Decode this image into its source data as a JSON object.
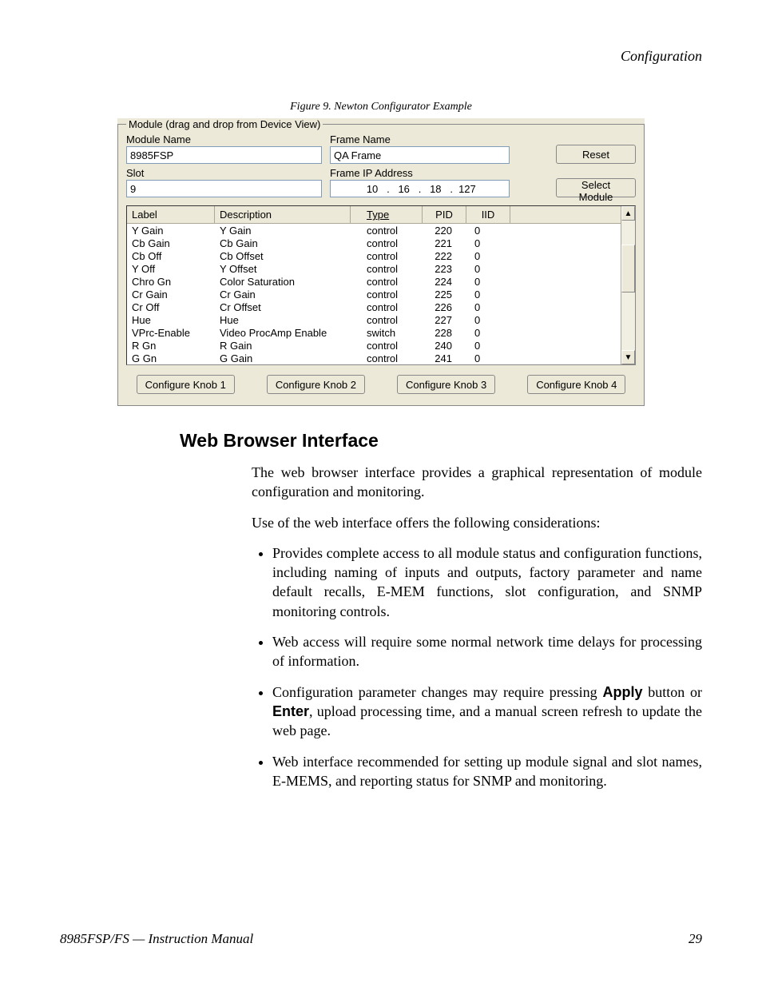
{
  "header": {
    "section": "Configuration"
  },
  "figure": {
    "caption": "Figure 9.  Newton Configurator Example"
  },
  "configurator": {
    "legend": "Module (drag and drop from Device View)",
    "module_name_label": "Module Name",
    "module_name_value": "8985FSP",
    "frame_name_label": "Frame Name",
    "frame_name_value": "QA Frame",
    "slot_label": "Slot",
    "slot_value": "9",
    "frame_ip_label": "Frame IP Address",
    "ip": {
      "o1": "10",
      "o2": "16",
      "o3": "18",
      "o4": "127"
    },
    "reset_btn": "Reset",
    "select_btn": "Select Module",
    "headers": {
      "label": "Label",
      "description": "Description",
      "type": "Type",
      "pid": "PID",
      "iid": "IID"
    },
    "rows": [
      {
        "label": "Y Gain",
        "desc": "Y Gain",
        "type": "control",
        "pid": "220",
        "iid": "0"
      },
      {
        "label": "Cb Gain",
        "desc": "Cb Gain",
        "type": "control",
        "pid": "221",
        "iid": "0"
      },
      {
        "label": "Cb Off",
        "desc": "Cb Offset",
        "type": "control",
        "pid": "222",
        "iid": "0"
      },
      {
        "label": "Y Off",
        "desc": "Y Offset",
        "type": "control",
        "pid": "223",
        "iid": "0"
      },
      {
        "label": "Chro Gn",
        "desc": "Color Saturation",
        "type": "control",
        "pid": "224",
        "iid": "0"
      },
      {
        "label": "Cr Gain",
        "desc": "Cr Gain",
        "type": "control",
        "pid": "225",
        "iid": "0"
      },
      {
        "label": "Cr Off",
        "desc": "Cr Offset",
        "type": "control",
        "pid": "226",
        "iid": "0"
      },
      {
        "label": "Hue",
        "desc": "Hue",
        "type": "control",
        "pid": "227",
        "iid": "0"
      },
      {
        "label": "VPrc-Enable",
        "desc": "Video ProcAmp Enable",
        "type": "switch",
        "pid": "228",
        "iid": "0"
      },
      {
        "label": "R Gn",
        "desc": "R Gain",
        "type": "control",
        "pid": "240",
        "iid": "0"
      },
      {
        "label": "G Gn",
        "desc": "G Gain",
        "type": "control",
        "pid": "241",
        "iid": "0"
      }
    ],
    "knobs": {
      "k1": "Configure Knob 1",
      "k2": "Configure Knob 2",
      "k3": "Configure Knob 3",
      "k4": "Configure Knob 4"
    }
  },
  "section": {
    "title": "Web Browser Interface",
    "p1": "The web browser interface provides a graphical representation of module configuration and monitoring.",
    "p2": "Use of the web interface offers the following considerations:",
    "li1": "Provides complete access to all module status and configuration functions, including naming of inputs and outputs, factory parameter and name default recalls, E-MEM functions, slot configuration, and SNMP monitoring controls.",
    "li2": "Web access will require some normal network time delays for processing of information.",
    "li3a": "Configuration parameter changes may require pressing ",
    "li3_apply": "Apply",
    "li3b": " button or ",
    "li3_enter": "Enter",
    "li3c": ", upload processing time, and a manual screen refresh to update the web page.",
    "li4": "Web interface recommended for setting up module signal and slot names, E-MEMS, and reporting status for SNMP and monitoring."
  },
  "footer": {
    "left": "8985FSP/FS — Instruction Manual",
    "right": "29"
  }
}
